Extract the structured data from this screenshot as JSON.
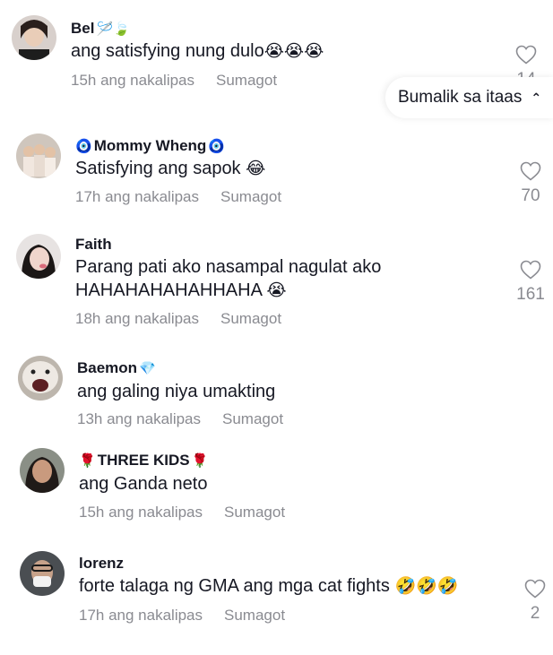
{
  "comments": [
    {
      "user": "Bel",
      "badge": "🪡🍃",
      "text": "ang satisfying nung dulo",
      "text_emoji": "😭😭😭",
      "text2": "",
      "text2_emoji": "",
      "time": "15h ang nakalipas",
      "reply": "Sumagot",
      "likes": "14"
    },
    {
      "user": "Mommy Wheng",
      "badge_pre": "🧿",
      "badge": "🧿",
      "text": "Satisfying ang sapok",
      "text_emoji": "😂",
      "text2": "",
      "text2_emoji": "",
      "time": "17h ang nakalipas",
      "reply": "Sumagot",
      "likes": "70"
    },
    {
      "user": "Faith",
      "badge": "",
      "text": "Parang pati ako nasampal nagulat ako",
      "text_emoji": "",
      "text2": "HAHAHAHAHAHHAHA",
      "text2_emoji": "😭",
      "time": "18h ang nakalipas",
      "reply": "Sumagot",
      "likes": "161"
    },
    {
      "user": "Baemon",
      "badge": "💎",
      "text": "ang galing niya umakting",
      "text_emoji": "",
      "text2": "",
      "text2_emoji": "",
      "time": "13h ang nakalipas",
      "reply": "Sumagot",
      "likes": ""
    },
    {
      "user": "THREE KIDS",
      "badge_pre": "🌹",
      "badge": "🌹",
      "text": "ang Ganda neto",
      "text_emoji": "",
      "text2": "",
      "text2_emoji": "",
      "time": "15h ang nakalipas",
      "reply": "Sumagot",
      "likes": ""
    },
    {
      "user": "lorenz",
      "badge": "",
      "text": "forte talaga ng GMA ang mga cat fights",
      "text_emoji": "🤣🤣🤣",
      "text2": "",
      "text2_emoji": "",
      "time": "17h ang nakalipas",
      "reply": "Sumagot",
      "likes": "2"
    }
  ],
  "back_to_top": {
    "label": "Bumalik sa itaas",
    "icon": "chevron-up-double-icon"
  },
  "colors": {
    "text": "#161823",
    "meta": "#8a8b91",
    "background": "#ffffff"
  }
}
